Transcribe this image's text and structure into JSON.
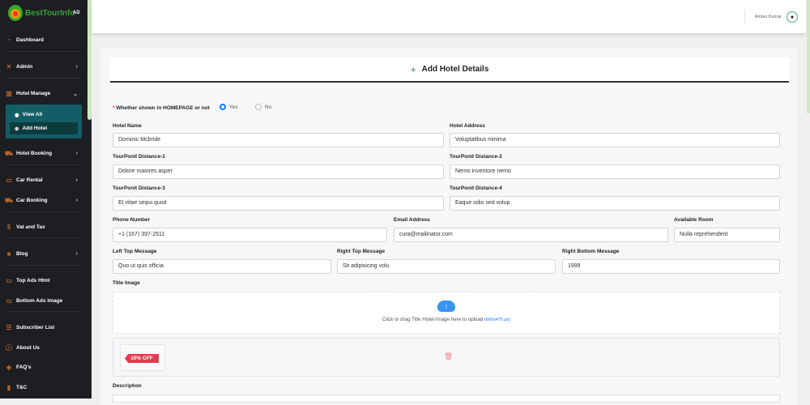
{
  "brand": {
    "name": "BestTourInfo",
    "badge": "AD"
  },
  "sidebar": {
    "items": [
      {
        "label": "Dashboard",
        "icon": "dashboard-icon"
      },
      {
        "label": "Admin",
        "icon": "tools-icon"
      },
      {
        "label": "Hotel Manage",
        "icon": "bank-icon"
      },
      {
        "label": "Hotel Booking",
        "icon": "cart-icon"
      },
      {
        "label": "Car Rental",
        "icon": "truck-icon"
      },
      {
        "label": "Car Booking",
        "icon": "cart-icon"
      },
      {
        "label": "Vat and Tax",
        "icon": "dollar-icon"
      },
      {
        "label": "Blog",
        "icon": "blog-icon"
      },
      {
        "label": "Top Ads Html",
        "icon": "ad-icon"
      },
      {
        "label": "Bottom Ads Image",
        "icon": "ad-icon"
      },
      {
        "label": "Subscriber List",
        "icon": "list-icon"
      },
      {
        "label": "About Us",
        "icon": "info-icon"
      },
      {
        "label": "FAQ's",
        "icon": "faq-icon"
      },
      {
        "label": "T&C",
        "icon": "file-icon"
      }
    ],
    "submenu": [
      {
        "label": "View All"
      },
      {
        "label": "Add Hotel"
      }
    ]
  },
  "header": {
    "user": "Amlan Kumar"
  },
  "form": {
    "title": "Add Hotel Details",
    "homepage": {
      "label": "Whether shown in HOMEPAGE or not",
      "yes": "Yes",
      "no": "No",
      "selected": "Yes"
    },
    "hotel_name": {
      "label": "Hotel Name",
      "value": "Dominic Mcbride"
    },
    "hotel_address": {
      "label": "Hotel Address",
      "value": "Voluptatibus minima"
    },
    "tp1": {
      "label": "TourPonit Distance-1",
      "value": "Dolore maiores asper"
    },
    "tp2": {
      "label": "TourPonit Distance-2",
      "value": "Nemo inventore nemo"
    },
    "tp3": {
      "label": "TourPonit Distance-3",
      "value": "Et vitae sequi quod"
    },
    "tp4": {
      "label": "TourPonit Distance-4",
      "value": "Eaque odio sed volup"
    },
    "phone": {
      "label": "Phone Number",
      "value": "+1 (167) 397-2511"
    },
    "email": {
      "label": "Email Address",
      "value": "cura@mailinator.com"
    },
    "room": {
      "label": "Available Room",
      "value": "Nulla reprehenderit"
    },
    "ltm": {
      "label": "Left Top Message",
      "value": "Quo ut quis officia"
    },
    "rtm": {
      "label": "Right Top Message",
      "value": "Sit adipisicing volu"
    },
    "rbm": {
      "label": "Right Bottom Message",
      "value": "1999"
    },
    "title_image": {
      "label": "Title Image",
      "upload_text": "Click or drag Title Hotel-Image here to upload",
      "size_hint": "(600x475 px)",
      "preview_tag": "10% OFF"
    },
    "description": {
      "label": "Description"
    }
  }
}
